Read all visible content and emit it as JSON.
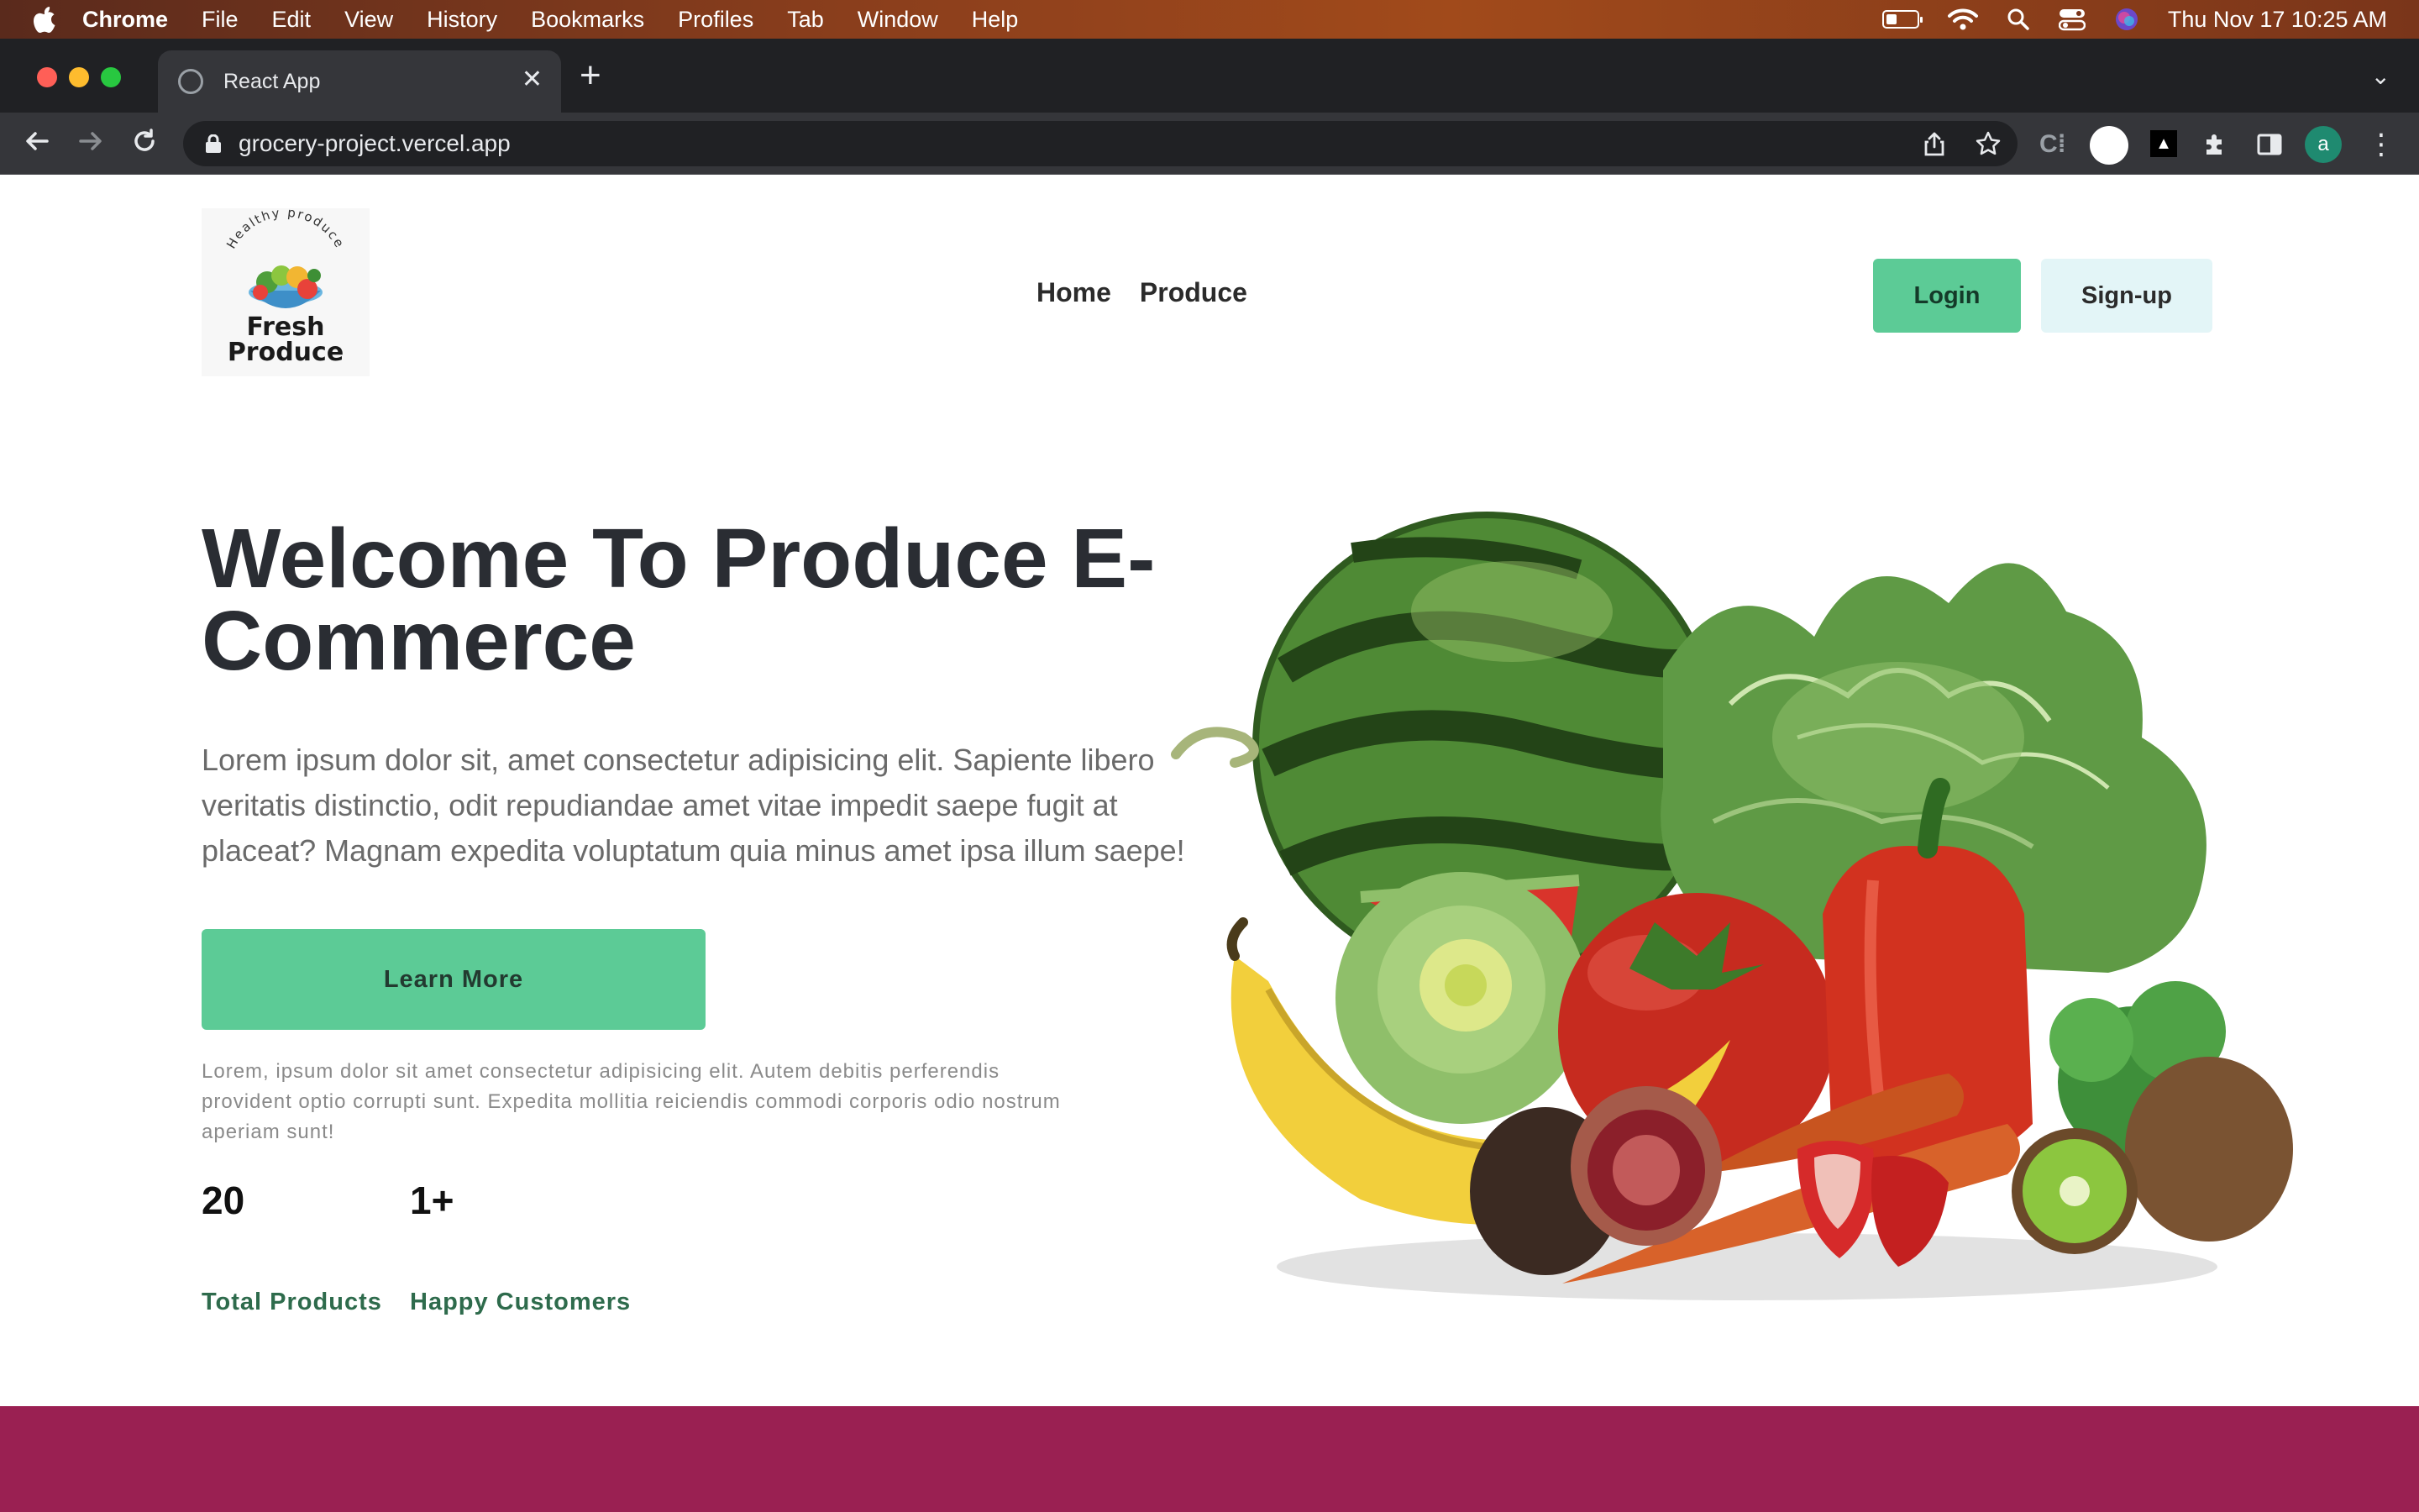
{
  "menubar": {
    "app_name": "Chrome",
    "items": [
      "File",
      "Edit",
      "View",
      "History",
      "Bookmarks",
      "Profiles",
      "Tab",
      "Window",
      "Help"
    ],
    "clock": "Thu Nov 17  10:25 AM"
  },
  "browser": {
    "tab_title": "React App",
    "url": "grocery-project.vercel.app",
    "profile_initial": "a"
  },
  "header": {
    "logo_arc_text": "Healthy produce",
    "logo_line1": "Fresh",
    "logo_line2": "Produce",
    "nav": [
      "Home",
      "Produce"
    ],
    "login_label": "Login",
    "signup_label": "Sign-up"
  },
  "hero": {
    "title": "Welcome To Produce E-Commerce",
    "description": "Lorem ipsum dolor sit, amet consectetur adipisicing elit. Sapiente libero veritatis distinctio, odit repudiandae amet vitae impedit saepe fugit at placeat? Magnam expedita voluptatum quia minus amet ipsa illum saepe!",
    "cta_label": "Learn More",
    "small_text": "Lorem, ipsum dolor sit amet consectetur adipisicing elit. Autem debitis perferendis provident optio corrupti sunt. Expedita mollitia reiciendis commodi corporis odio nostrum aperiam sunt!",
    "stats": [
      {
        "value": "20",
        "label": "Total Products"
      },
      {
        "value": "1+",
        "label": "Happy Customers"
      }
    ]
  },
  "colors": {
    "accent_green": "#5ccb96",
    "signup_bg": "#e3f5f7",
    "footer_band": "#9a2052",
    "title_text": "#2a2d33",
    "stat_label": "#2e6b4c"
  }
}
